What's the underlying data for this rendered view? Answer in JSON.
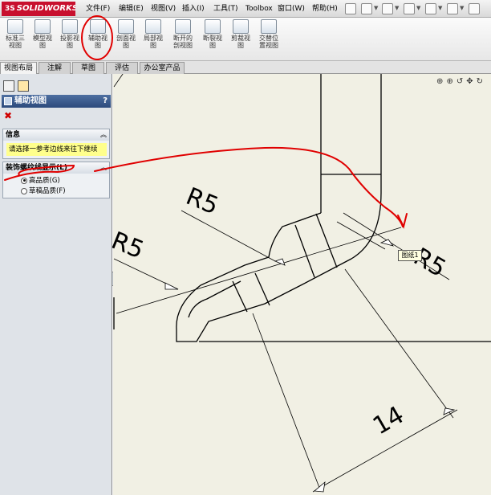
{
  "app": {
    "logo_text": "SOLIDWORKS",
    "logo_prefix": "3S"
  },
  "menu": {
    "items": [
      "文件(F)",
      "编辑(E)",
      "视图(V)",
      "插入(I)",
      "工具(T)",
      "Toolbox",
      "窗口(W)",
      "帮助(H)"
    ]
  },
  "toolbar": {
    "buttons": [
      {
        "label": "标准三\n视图",
        "icon": "standard-views-icon"
      },
      {
        "label": "模型视\n图",
        "icon": "model-view-icon"
      },
      {
        "label": "投影视\n图",
        "icon": "projected-view-icon"
      },
      {
        "label": "辅助视\n图",
        "icon": "auxiliary-view-icon"
      },
      {
        "label": "剖面视\n图",
        "icon": "section-view-icon"
      },
      {
        "label": "局部视\n图",
        "icon": "detail-view-icon"
      },
      {
        "label": "断开的\n剖视图",
        "icon": "broken-out-section-icon"
      },
      {
        "label": "断裂视\n图",
        "icon": "break-view-icon"
      },
      {
        "label": "剪裁视\n图",
        "icon": "crop-view-icon"
      },
      {
        "label": "交替位\n置视图",
        "icon": "alternate-position-view-icon"
      }
    ]
  },
  "tabs": [
    "视图布局",
    "注解",
    "草图",
    "评估",
    "办公室产品"
  ],
  "property_manager": {
    "title": "辅助视图",
    "help": "?",
    "close_glyph": "✖",
    "info": {
      "header": "信息",
      "message": "请选择一参考边线来往下继续"
    },
    "display": {
      "header": "装饰螺纹线显示(L)",
      "options": [
        {
          "label": "高品质(G)",
          "selected": true
        },
        {
          "label": "草稿品质(F)",
          "selected": false
        }
      ]
    }
  },
  "drawing": {
    "dimensions": [
      "R5",
      "R5",
      "R5",
      "14"
    ],
    "tooltip": "图纸1"
  },
  "colors": {
    "annotation_red": "#e00000",
    "canvas_bg": "#f1f0e4"
  }
}
